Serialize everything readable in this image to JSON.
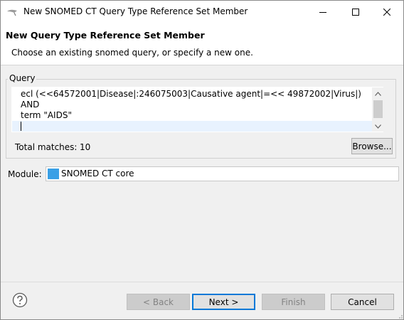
{
  "window": {
    "title": "New SNOMED CT Query Type Reference Set Member"
  },
  "header": {
    "title": "New Query Type Reference Set Member",
    "description": "Choose an existing snomed query, or specify a new one."
  },
  "query_group": {
    "label": "Query",
    "lines": [
      "ecl (<<64572001|Disease|:246075003|Causative agent|=<< 49872002|Virus|)",
      "AND",
      "term \"AIDS\""
    ],
    "total_matches_label": "Total matches:",
    "total_matches_value": "10",
    "browse_label": "Browse..."
  },
  "module": {
    "label": "Module:",
    "value": "SNOMED CT core",
    "icon": "snomed-module-icon"
  },
  "footer": {
    "help_icon": "help-icon",
    "back_label": "< Back",
    "next_label": "Next >",
    "finish_label": "Finish",
    "cancel_label": "Cancel"
  },
  "colors": {
    "accent": "#0078d7",
    "header_bg": "#ffffff",
    "dialog_bg": "#f0f0f0",
    "current_line": "#e8f2fe"
  }
}
